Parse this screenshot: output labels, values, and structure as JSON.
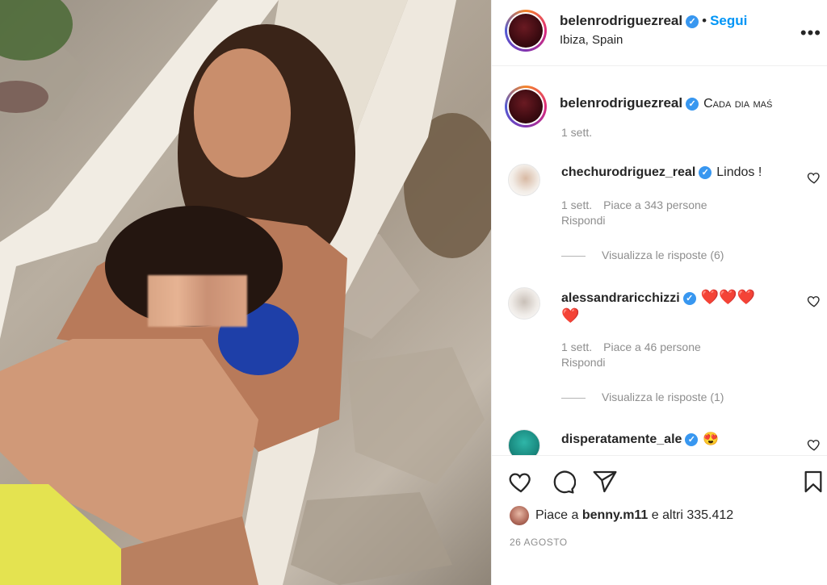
{
  "colors": {
    "link_blue": "#0095f6",
    "verified_blue": "#3897f0",
    "secondary_text": "#8e8e8e",
    "heart_red": "#ed4956"
  },
  "header": {
    "username": "belenrodriguezreal",
    "follow_separator": "•",
    "follow_label": "Segui",
    "location": "Ibiza, Spain",
    "more_icon": "ellipsis-icon"
  },
  "caption": {
    "username": "belenrodriguezreal",
    "text": "Cada dia maś",
    "time": "1 sett."
  },
  "comments": [
    {
      "username": "chechurodriguez_real",
      "text": "Lindos !",
      "time": "1 sett.",
      "likes": "Piace a 343 persone",
      "reply": "Rispondi",
      "view_replies": "Visualizza le risposte (6)"
    },
    {
      "username": "alessandraricchizzi",
      "text": "❤️❤️❤️",
      "text_line2": "❤️",
      "time": "1 sett.",
      "likes": "Piace a 46 persone",
      "reply": "Rispondi",
      "view_replies": "Visualizza le risposte (1)"
    },
    {
      "username": "disperatamente_ale",
      "text": "😍"
    }
  ],
  "actions": {
    "like_icon": "heart-icon",
    "comment_icon": "comment-icon",
    "share_icon": "paper-plane-icon",
    "save_icon": "bookmark-icon"
  },
  "likes": {
    "prefix": "Piace a ",
    "user": "benny.m11",
    "suffix": " e altri 335.412"
  },
  "date": "26 AGOSTO"
}
